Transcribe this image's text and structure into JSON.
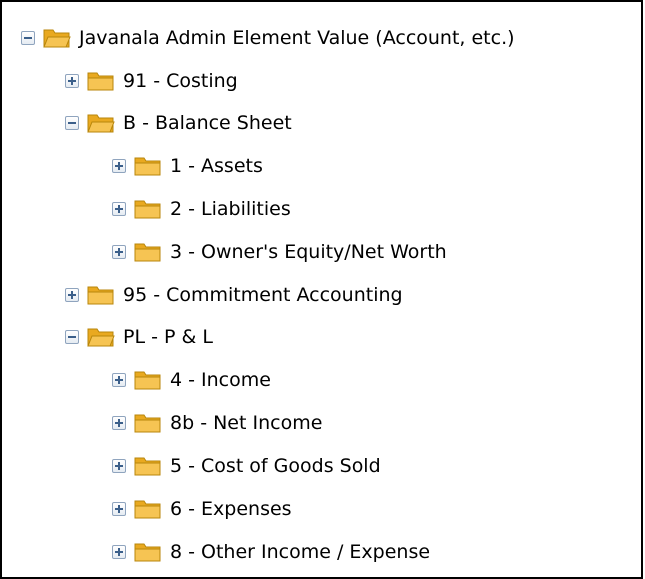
{
  "tree": {
    "root": {
      "label": "Javanala Admin Element Value (Account, etc.)",
      "state": "expanded",
      "icon": "folder-open-icon"
    },
    "items": [
      {
        "label": "91 - Costing",
        "state": "collapsed",
        "level": 1
      },
      {
        "label": "B - Balance Sheet",
        "state": "expanded",
        "level": 1
      },
      {
        "label": "1 - Assets",
        "state": "collapsed",
        "level": 2
      },
      {
        "label": "2 - Liabilities",
        "state": "collapsed",
        "level": 2
      },
      {
        "label": "3 - Owner's Equity/Net Worth",
        "state": "collapsed",
        "level": 2
      },
      {
        "label": "95 - Commitment Accounting",
        "state": "collapsed",
        "level": 1
      },
      {
        "label": "PL - P & L",
        "state": "expanded",
        "level": 1
      },
      {
        "label": "4 - Income",
        "state": "collapsed",
        "level": 2
      },
      {
        "label": "8b - Net Income",
        "state": "collapsed",
        "level": 2
      },
      {
        "label": "5 - Cost of Goods Sold",
        "state": "collapsed",
        "level": 2
      },
      {
        "label": "6 - Expenses",
        "state": "collapsed",
        "level": 2
      },
      {
        "label": "8 - Other Income / Expense",
        "state": "collapsed",
        "level": 2
      }
    ]
  },
  "colors": {
    "folder_fill": "#f6c453",
    "folder_stroke": "#b8860b",
    "toggle_border": "#8fa4be",
    "toggle_glyph": "#3b5f8a"
  }
}
